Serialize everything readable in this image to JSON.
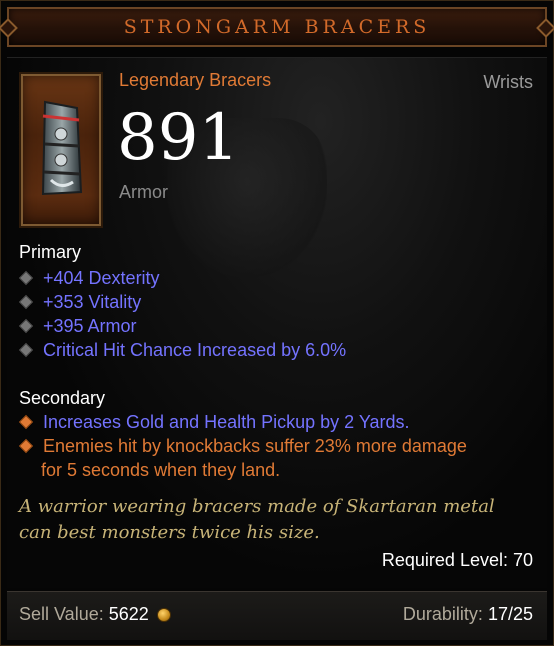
{
  "header": {
    "title": "STRONGARM BRACERS"
  },
  "item": {
    "type_label": "Legendary Bracers",
    "slot": "Wrists",
    "armor_value": "891",
    "armor_label": "Armor",
    "icon": "bracer-icon"
  },
  "primary": {
    "label": "Primary",
    "stats": [
      "+404 Dexterity",
      "+353 Vitality",
      "+395 Armor",
      "Critical Hit Chance Increased by 6.0%"
    ]
  },
  "secondary": {
    "label": "Secondary",
    "stats": [
      "Increases Gold and Health Pickup by 2 Yards.",
      "Enemies hit by knockbacks suffer 23% more damage",
      "for 5 seconds when they land."
    ]
  },
  "flavor": {
    "line1": "A warrior wearing bracers made of Skartaran metal",
    "line2": "can best monsters twice his size."
  },
  "required_level": "Required Level: 70",
  "footer": {
    "sell_label": "Sell Value:",
    "sell_value": "5622",
    "coin_icon": "gold-coin-icon",
    "durability_label": "Durability:",
    "durability_value": "17/25"
  },
  "colors": {
    "legendary": "#e07a35",
    "magic": "#7473ff",
    "flavor": "#c7b377"
  }
}
